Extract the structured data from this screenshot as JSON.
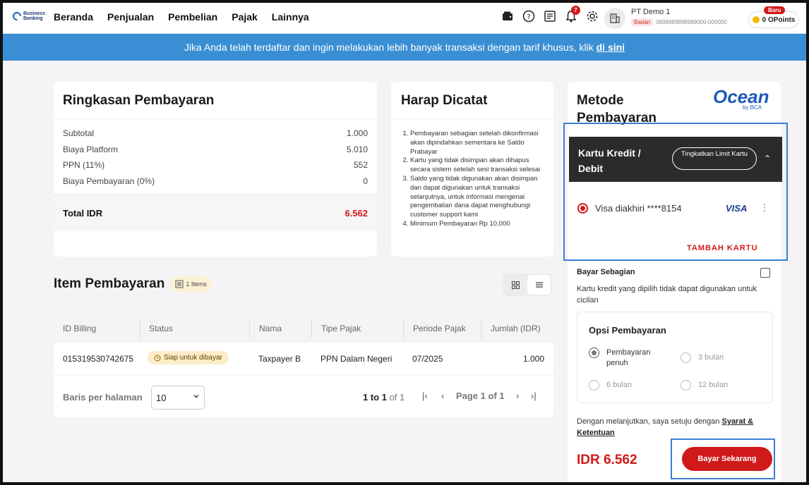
{
  "brand": {
    "logo_text": "Business Banking"
  },
  "nav": {
    "items": [
      {
        "label": "Beranda"
      },
      {
        "label": "Penjualan"
      },
      {
        "label": "Pembelian"
      },
      {
        "label": "Pajak"
      },
      {
        "label": "Lainnya"
      }
    ]
  },
  "header": {
    "notification_count": "7",
    "company_name": "PT Demo 1",
    "company_type": "Badan",
    "company_id": "0898989898989000-000000",
    "points_label": "0 OPoints",
    "new_badge": "Baru"
  },
  "banner": {
    "text": "Jika Anda telah terdaftar dan ingin melakukan lebih banyak transaksi dengan tarif khusus, klik ",
    "link": "di sini"
  },
  "summary": {
    "title": "Ringkasan Pembayaran",
    "rows": [
      {
        "label": "Subtotal",
        "value": "1.000"
      },
      {
        "label": "Biaya Platform",
        "value": "5.010"
      },
      {
        "label": "PPN (11%)",
        "value": "552"
      },
      {
        "label": "Biaya Pembayaran (0%)",
        "value": "0"
      }
    ],
    "total_label": "Total IDR",
    "total_value": "6.562"
  },
  "notes": {
    "title": "Harap Dicatat",
    "items": [
      "Pembayaran sebagian setelah dikonfirmasi akan dipindahkan sementara ke Saldo Prabayar",
      "Kartu yang tidak disimpan akan dihapus secara sistem setelah sesi transaksi selesai",
      "Saldo yang tidak digunakan akan disimpan dan dapat digunakan untuk transaksi selanjutnya, untuk informasi mengenai pengembalian dana dapat menghubungi customer support kami",
      "Minimum Pembayaran Rp 10,000"
    ]
  },
  "items": {
    "title": "Item Pembayaran",
    "count_badge": "1 Items",
    "columns": [
      "ID Billing",
      "Status",
      "Nama",
      "Tipe Pajak",
      "Periode Pajak",
      "Jumlah (IDR)"
    ],
    "rows": [
      {
        "id": "015319530742675",
        "status": "Siap untuk dibayar",
        "name": "Taxpayer B",
        "type": "PPN Dalam Negeri",
        "period": "07/2025",
        "amount": "1.000"
      }
    ],
    "pager": {
      "rows_label": "Baris per halaman",
      "rows_value": "10",
      "range_a": "1 to ",
      "range_b": "1",
      "range_c": " of 1",
      "page_label": "Page 1 of 1"
    }
  },
  "method": {
    "title": "Metode Pembayaran",
    "ocean_logo": "Ocean",
    "ocean_sub": "by BCA",
    "card_section": "Kartu Kredit / Debit",
    "upgrade_label": "Tingkatkan Limit Kartu",
    "card_label": "Visa diakhiri ****8154",
    "card_brand": "VISA",
    "add_card": "TAMBAH KARTU",
    "partial_label": "Bayar Sebagian",
    "partial_note": "Kartu kredit yang dipilih tidak dapat digunakan untuk cicilan",
    "options_title": "Opsi Pembayaran",
    "options": [
      {
        "label": "Pembayaran penuh"
      },
      {
        "label": "3 bulan"
      },
      {
        "label": "6 bulan"
      },
      {
        "label": "12 bulan"
      }
    ],
    "agree_text": "Dengan melanjutkan, saya setuju dengan ",
    "agree_link": "Syarat & Ketentuan",
    "amount": "IDR 6.562",
    "pay_label": "Bayar Sekarang"
  },
  "colors": {
    "accent": "#d01919",
    "banner": "#3a8fd4",
    "highlight": "#3b7ed0"
  }
}
